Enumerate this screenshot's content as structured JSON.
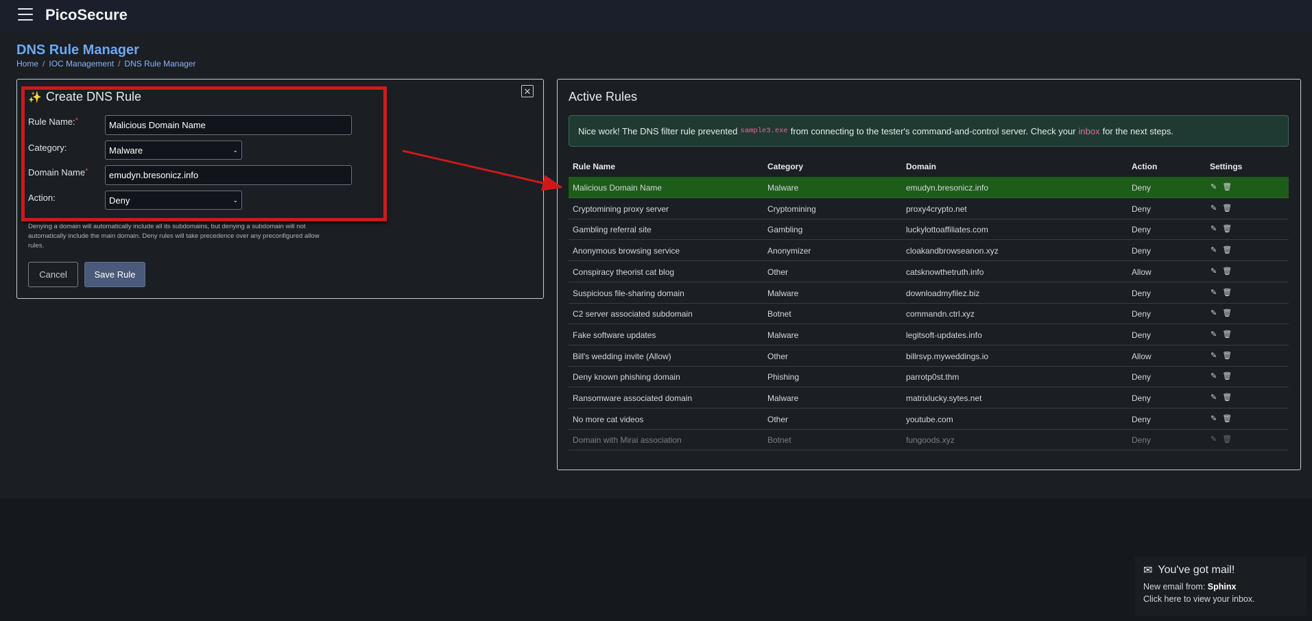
{
  "app": {
    "brand": "PicoSecure"
  },
  "page": {
    "title": "DNS Rule Manager",
    "breadcrumb": [
      "Home",
      "IOC Management",
      "DNS Rule Manager"
    ],
    "breadcrumb_sep": "/"
  },
  "form": {
    "title": "Create DNS Rule",
    "rule_name_label": "Rule Name:",
    "rule_name_value": "Malicious Domain Name",
    "category_label": "Category:",
    "category_value": "Malware",
    "domain_label": "Domain Name",
    "domain_value": "emudyn.bresonicz.info",
    "action_label": "Action:",
    "action_value": "Deny",
    "required_mark": "*",
    "help": "Denying a domain will automatically include all its subdomains, but denying a subdomain will not automatically include the main domain. Deny rules will take precedence over any preconfigured allow rules.",
    "cancel_label": "Cancel",
    "save_label": "Save Rule"
  },
  "active": {
    "title": "Active Rules",
    "alert": {
      "pre": "Nice work! The DNS filter rule prevented",
      "code": "sample3.exe",
      "mid": "from connecting to the tester's command-and-control server. Check your",
      "link": "inbox",
      "post": "for the next steps.",
      "color": "#1f3a32"
    },
    "columns": [
      "Rule Name",
      "Category",
      "Domain",
      "Action",
      "Settings"
    ],
    "rows": [
      {
        "name": "Malicious Domain Name",
        "category": "Malware",
        "domain": "emudyn.bresonicz.info",
        "action": "Deny"
      },
      {
        "name": "Cryptomining proxy server",
        "category": "Cryptomining",
        "domain": "proxy4crypto.net",
        "action": "Deny"
      },
      {
        "name": "Gambling referral site",
        "category": "Gambling",
        "domain": "luckylottoaffiliates.com",
        "action": "Deny"
      },
      {
        "name": "Anonymous browsing service",
        "category": "Anonymizer",
        "domain": "cloakandbrowseanon.xyz",
        "action": "Deny"
      },
      {
        "name": "Conspiracy theorist cat blog",
        "category": "Other",
        "domain": "catsknowthetruth.info",
        "action": "Allow"
      },
      {
        "name": "Suspicious file-sharing domain",
        "category": "Malware",
        "domain": "downloadmyfilez.biz",
        "action": "Deny"
      },
      {
        "name": "C2 server associated subdomain",
        "category": "Botnet",
        "domain": "commandn.ctrl.xyz",
        "action": "Deny"
      },
      {
        "name": "Fake software updates",
        "category": "Malware",
        "domain": "legitsoft-updates.info",
        "action": "Deny"
      },
      {
        "name": "Bill's wedding invite (Allow)",
        "category": "Other",
        "domain": "billrsvp.myweddings.io",
        "action": "Allow"
      },
      {
        "name": "Deny known phishing domain",
        "category": "Phishing",
        "domain": "parrotp0st.thm",
        "action": "Deny"
      },
      {
        "name": "Ransomware associated domain",
        "category": "Malware",
        "domain": "matrixlucky.sytes.net",
        "action": "Deny"
      },
      {
        "name": "No more cat videos",
        "category": "Other",
        "domain": "youtube.com",
        "action": "Deny"
      },
      {
        "name": "Domain with Mirai association",
        "category": "Botnet",
        "domain": "fungoods.xyz",
        "action": "Deny"
      }
    ],
    "highlight_color": "#1e5c1a"
  },
  "toast": {
    "title": "You've got mail!",
    "from_label": "New email from:",
    "from_name": "Sphinx",
    "cta": "Click here to view your inbox."
  },
  "icons": [
    "menu-icon",
    "wand-icon",
    "close-icon",
    "chevron-down-icon",
    "edit-icon",
    "trash-icon",
    "mail-icon"
  ],
  "annotation_color": "#cc1a1a"
}
